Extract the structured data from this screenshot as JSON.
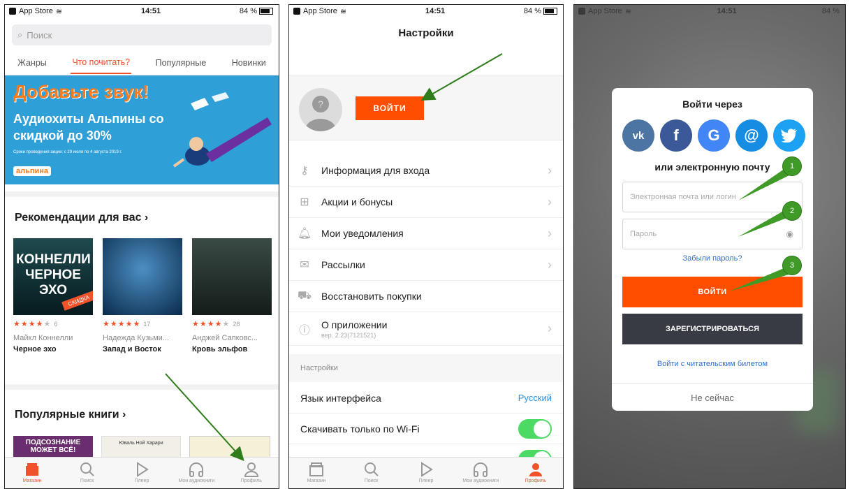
{
  "statusbar": {
    "carrier": "App Store",
    "time": "14:51",
    "battery": "84 %"
  },
  "screen1": {
    "search_placeholder": "Поиск",
    "tabs": [
      "Жанры",
      "Что почитать?",
      "Популярные",
      "Новинки"
    ],
    "banner": {
      "title": "Добавьте звук!",
      "subtitle": "Аудиохиты Альпины со скидкой до 30%",
      "fine_print": "Сроки проведения акции: с 29 июля по 4 августа 2019 г.",
      "logo": "альпина"
    },
    "recommend_title": "Рекомендации для вас",
    "books": [
      {
        "author": "Майкл Коннелли",
        "title": "Черное эхо",
        "rating": 4,
        "count": "6",
        "cover_text": "КОННЕЛЛИ ЧЕРНОЕ ЭХО",
        "sale": "СКИДКА"
      },
      {
        "author": "Надежда Кузьми...",
        "title": "Запад и Восток",
        "rating": 5,
        "count": "17"
      },
      {
        "author": "Анджей Сапковс...",
        "title": "Кровь эльфов",
        "rating": 4,
        "count": "28"
      }
    ],
    "popular_title": "Популярные книги",
    "popular_cover_1": "ПОДСОЗНАНИЕ МОЖЕТ ВСЁ!",
    "popular_cover_2": "Юваль Ной Харари",
    "tabbar": [
      "Магазин",
      "Поиск",
      "Плеер",
      "Мои аудиокниги",
      "Профиль"
    ]
  },
  "screen2": {
    "title": "Настройки",
    "login_button": "ВОЙТИ",
    "menu": [
      {
        "label": "Информация для входа",
        "icon": "key-icon"
      },
      {
        "label": "Акции и бонусы",
        "icon": "gift-icon"
      },
      {
        "label": "Мои уведомления",
        "icon": "bell-icon"
      },
      {
        "label": "Рассылки",
        "icon": "mail-icon"
      },
      {
        "label": "Восстановить покупки",
        "icon": "cart-icon"
      },
      {
        "label": "О приложении",
        "sub": "вер. 2.23(7121521)",
        "icon": "info-icon"
      }
    ],
    "settings_header": "Настройки",
    "language_label": "Язык интерфейса",
    "language_value": "Русский",
    "wifi_label": "Скачивать только по Wi-Fi",
    "tabbar": [
      "Магазин",
      "Поиск",
      "Плеер",
      "Мои аудиокниги",
      "Профиль"
    ]
  },
  "screen3": {
    "title": "Войти через",
    "socials": [
      {
        "name": "vk",
        "glyph": "vk",
        "color": "#4c75a3"
      },
      {
        "name": "facebook",
        "glyph": "f",
        "color": "#3b5998"
      },
      {
        "name": "google",
        "glyph": "G",
        "color": "#4285f4"
      },
      {
        "name": "mail",
        "glyph": "@",
        "color": "#168de2"
      },
      {
        "name": "twitter",
        "glyph": "t",
        "color": "#1da1f2"
      }
    ],
    "or_email": "или электронную почту",
    "email_placeholder": "Электронная почта или логин",
    "password_placeholder": "Пароль",
    "forgot": "Забыли пароль?",
    "login_button": "ВОЙТИ",
    "register_button": "ЗАРЕГИСТРИРОВАТЬСЯ",
    "reader_ticket": "Войти с читательским билетом",
    "not_now": "Не сейчас",
    "badges": [
      "1",
      "2",
      "3"
    ]
  },
  "colors": {
    "accent": "#ff4e00",
    "link": "#2f6fd1",
    "annotation": "#3f9a28"
  }
}
